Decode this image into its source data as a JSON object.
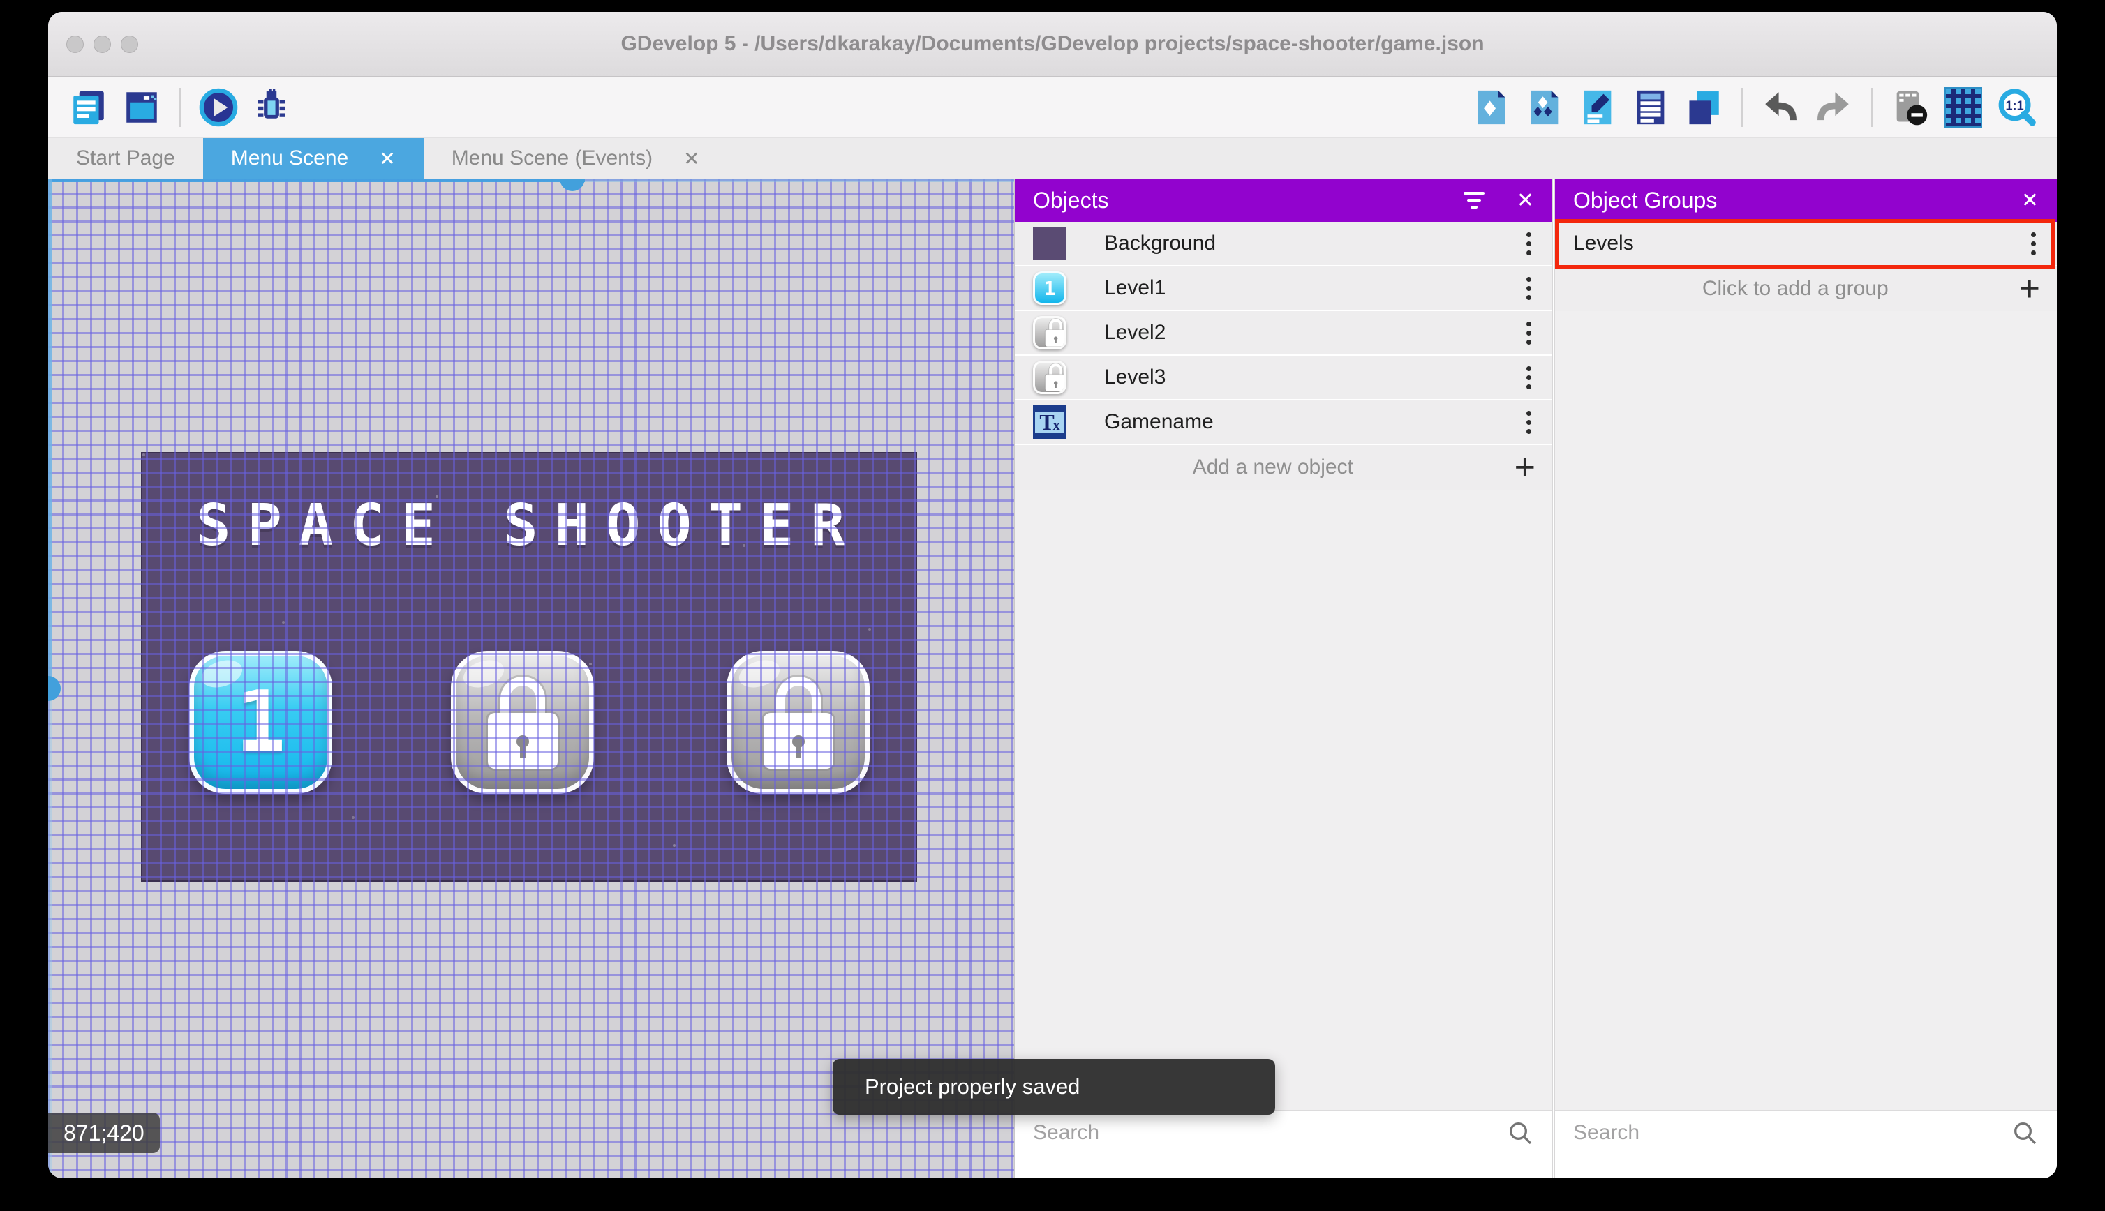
{
  "titlebar": {
    "title": "GDevelop 5 - /Users/dkarakay/Documents/GDevelop projects/space-shooter/game.json"
  },
  "tabs": {
    "start": "Start Page",
    "scene": "Menu Scene",
    "events": "Menu Scene (Events)"
  },
  "icons": {
    "close": "✕",
    "plus": "+",
    "level1_glyph": "1",
    "gamename_t": "T",
    "gamename_x": "x"
  },
  "scene_canvas": {
    "coordinate_badge": "871;420",
    "game": {
      "title": "SPACE SHOOTER",
      "level1_label": "1"
    }
  },
  "objects_panel": {
    "title": "Objects",
    "rows": [
      {
        "name": "Background"
      },
      {
        "name": "Level1"
      },
      {
        "name": "Level2"
      },
      {
        "name": "Level3"
      },
      {
        "name": "Gamename"
      }
    ],
    "add_row_label": "Add a new object",
    "search_placeholder": "Search"
  },
  "groups_panel": {
    "title": "Object Groups",
    "rows": [
      {
        "name": "Levels"
      }
    ],
    "add_row_label": "Click to add a group",
    "search_placeholder": "Search"
  },
  "toast": {
    "message": "Project properly saved"
  },
  "colors": {
    "panel_header_purple": "#9203CE",
    "active_tab_blue": "#4BA7E0",
    "selection_blue": "#42A0DC",
    "annotation_red": "#F3270D",
    "scene_background_purple": "#584A71",
    "grid_line": "#6860E0",
    "canvas_background": "#D3D2D6",
    "toast_background": "#2F2F2F"
  }
}
